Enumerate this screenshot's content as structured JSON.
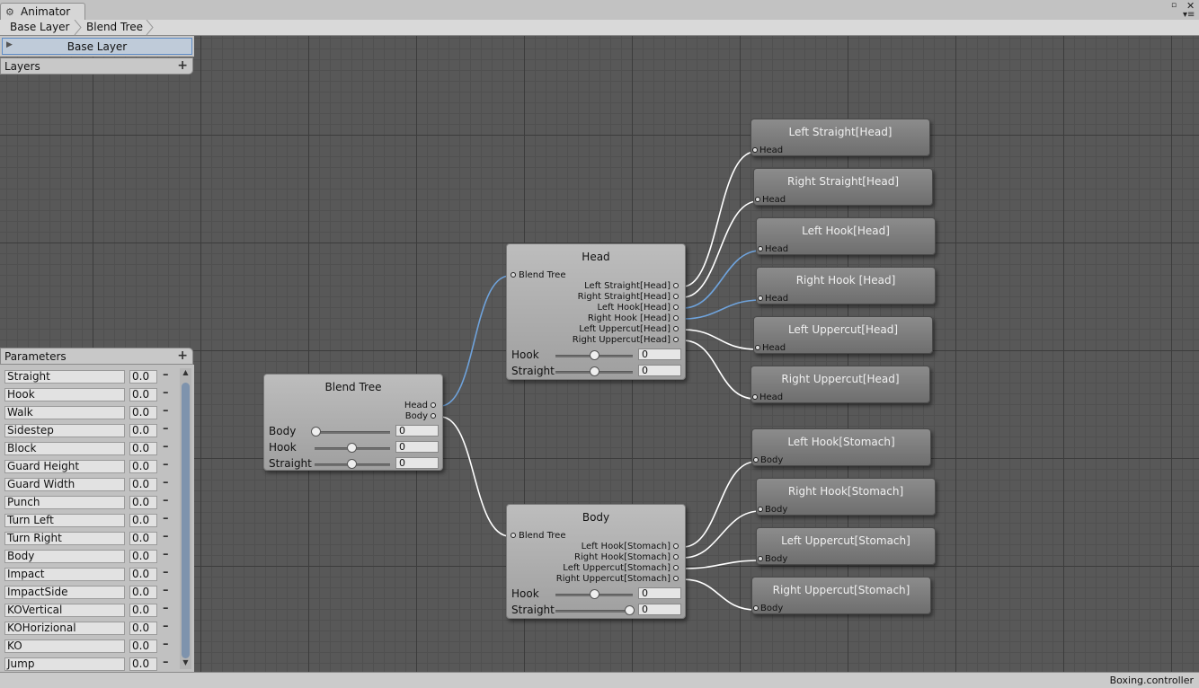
{
  "window": {
    "tab_title": "Animator",
    "tab_icon": "animator-icon"
  },
  "breadcrumb": [
    "Base Layer",
    "Blend Tree"
  ],
  "layers": {
    "selected_layer": "Base Layer",
    "header": "Layers"
  },
  "parameters": {
    "header": "Parameters",
    "items": [
      {
        "name": "Straight",
        "value": "0.0"
      },
      {
        "name": "Hook",
        "value": "0.0"
      },
      {
        "name": "Walk",
        "value": "0.0"
      },
      {
        "name": "Sidestep",
        "value": "0.0"
      },
      {
        "name": "Block",
        "value": "0.0"
      },
      {
        "name": "Guard Height",
        "value": "0.0"
      },
      {
        "name": "Guard Width",
        "value": "0.0"
      },
      {
        "name": "Punch",
        "value": "0.0"
      },
      {
        "name": "Turn Left",
        "value": "0.0"
      },
      {
        "name": "Turn Right",
        "value": "0.0"
      },
      {
        "name": "Body",
        "value": "0.0"
      },
      {
        "name": "Impact",
        "value": "0.0"
      },
      {
        "name": "ImpactSide",
        "value": "0.0"
      },
      {
        "name": "KOVertical",
        "value": "0.0"
      },
      {
        "name": "KOHorizional",
        "value": "0.0"
      },
      {
        "name": "KO",
        "value": "0.0"
      },
      {
        "name": "Jump",
        "value": "0.0"
      }
    ]
  },
  "nodes": {
    "root": {
      "title": "Blend Tree",
      "outputs": [
        "Head",
        "Body"
      ],
      "params": [
        {
          "label": "Body",
          "value": "0",
          "slider": 0.0
        },
        {
          "label": "Hook",
          "value": "0",
          "slider": 0.5
        },
        {
          "label": "Straight",
          "value": "0",
          "slider": 0.5
        }
      ]
    },
    "head": {
      "title": "Head",
      "input": "Blend Tree",
      "outputs": [
        "Left Straight[Head]",
        "Right Straight[Head]",
        "Left Hook[Head]",
        "Right Hook [Head]",
        "Left Uppercut[Head]",
        "Right Uppercut[Head]"
      ],
      "params": [
        {
          "label": "Hook",
          "value": "0",
          "slider": 0.5
        },
        {
          "label": "Straight",
          "value": "0",
          "slider": 0.5
        }
      ]
    },
    "body": {
      "title": "Body",
      "input": "Blend Tree",
      "outputs": [
        "Left Hook[Stomach]",
        "Right Hook[Stomach]",
        "Left Uppercut[Stomach]",
        "Right Uppercut[Stomach]"
      ],
      "params": [
        {
          "label": "Hook",
          "value": "0",
          "slider": 0.5
        },
        {
          "label": "Straight",
          "value": "0",
          "slider": 1.0
        }
      ]
    }
  },
  "leaves": [
    {
      "title": "Left Straight[Head]",
      "port": "Head"
    },
    {
      "title": "Right Straight[Head]",
      "port": "Head"
    },
    {
      "title": "Left Hook[Head]",
      "port": "Head"
    },
    {
      "title": "Right Hook [Head]",
      "port": "Head"
    },
    {
      "title": "Left Uppercut[Head]",
      "port": "Head"
    },
    {
      "title": "Right Uppercut[Head]",
      "port": "Head"
    },
    {
      "title": "Left Hook[Stomach]",
      "port": "Body"
    },
    {
      "title": "Right Hook[Stomach]",
      "port": "Body"
    },
    {
      "title": "Left Uppercut[Stomach]",
      "port": "Body"
    },
    {
      "title": "Right Uppercut[Stomach]",
      "port": "Body"
    }
  ],
  "status": {
    "file": "Boxing.controller"
  },
  "colors": {
    "active_wire": "#6fa3dc",
    "wire": "#ffffff",
    "selection": "#5e8cc6"
  }
}
